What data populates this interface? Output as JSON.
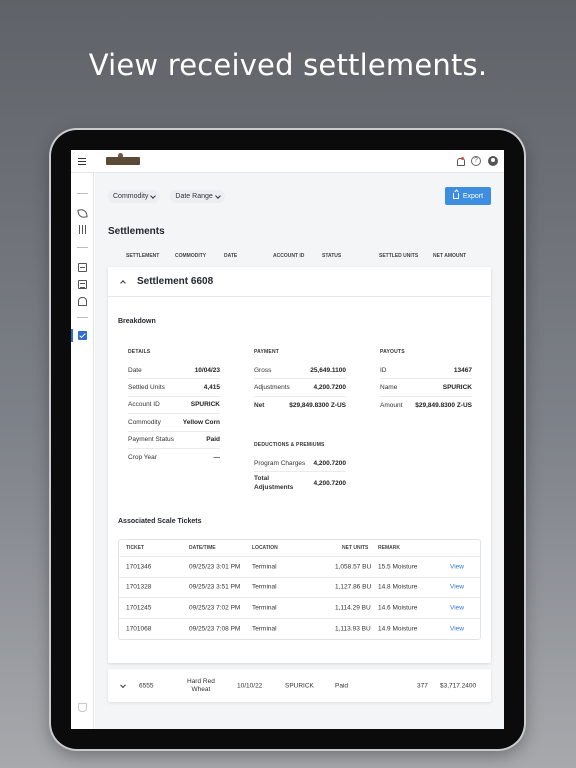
{
  "headline": "View received settlements.",
  "filters": {
    "commodity": "Commodity",
    "date_range": "Date Range"
  },
  "export_label": "Export",
  "page_title": "Settlements",
  "columns": [
    "SETTLEMENT",
    "COMMODITY",
    "DATE",
    "ACCOUNT ID",
    "STATUS",
    "SETTLED UNITS",
    "NET AMOUNT"
  ],
  "settlement": {
    "title": "Settlement 6608",
    "breakdown_label": "Breakdown",
    "details": {
      "heading": "DETAILS",
      "rows": [
        {
          "k": "Date",
          "v": "10/04/23"
        },
        {
          "k": "Settled Units",
          "v": "4,415"
        },
        {
          "k": "Account ID",
          "v": "SPURICK"
        },
        {
          "k": "Commodity",
          "v": "Yellow Corn"
        },
        {
          "k": "Payment Status",
          "v": "Paid"
        },
        {
          "k": "Crop Year",
          "v": "—"
        }
      ]
    },
    "payment": {
      "heading": "PAYMENT",
      "rows": [
        {
          "k": "Gross",
          "v": "25,649.1100"
        },
        {
          "k": "Adjustments",
          "v": "4,200.7200"
        },
        {
          "k": "Net",
          "v": "$29,849.8300 Z-US"
        }
      ]
    },
    "deductions": {
      "heading": "DEDUCTIONS & PREMIUMS",
      "rows": [
        {
          "k": "Program Charges",
          "v": "4,200.7200"
        },
        {
          "k": "Total Adjustments",
          "v": "4,200.7200"
        }
      ]
    },
    "payouts": {
      "heading": "PAYOUTS",
      "rows": [
        {
          "k": "ID",
          "v": "13467"
        },
        {
          "k": "Name",
          "v": "SPURICK"
        },
        {
          "k": "Amount",
          "v": "$29,849.8300 Z-US"
        }
      ]
    },
    "tickets": {
      "title": "Associated Scale Tickets",
      "headers": [
        "TICKET",
        "DATE/TIME",
        "LOCATION",
        "NET UNITS",
        "REMARK"
      ],
      "rows": [
        {
          "ticket": "1701346",
          "datetime": "09/25/23 3:01 PM",
          "location": "Terminal",
          "net": "1,058.57 BU",
          "remark": "15.5 Moisture",
          "action": "View"
        },
        {
          "ticket": "1701328",
          "datetime": "09/25/23 3:51 PM",
          "location": "Terminal",
          "net": "1,127.86 BU",
          "remark": "14.8 Moisture",
          "action": "View"
        },
        {
          "ticket": "1701245",
          "datetime": "09/25/23 7:02 PM",
          "location": "Terminal",
          "net": "1,114.29 BU",
          "remark": "14.6 Moisture",
          "action": "View"
        },
        {
          "ticket": "1701068",
          "datetime": "09/25/23 7:08 PM",
          "location": "Terminal",
          "net": "1,113.93 BU",
          "remark": "14.9 Moisture",
          "action": "View"
        }
      ]
    }
  },
  "other_settlement": {
    "id": "6555",
    "commodity_line1": "Hard Red",
    "commodity_line2": "Wheat",
    "date": "10/10/22",
    "account": "SPURICK",
    "status": "Paid",
    "units": "377",
    "amount": "$3,717.2400"
  },
  "help_glyph": "?"
}
